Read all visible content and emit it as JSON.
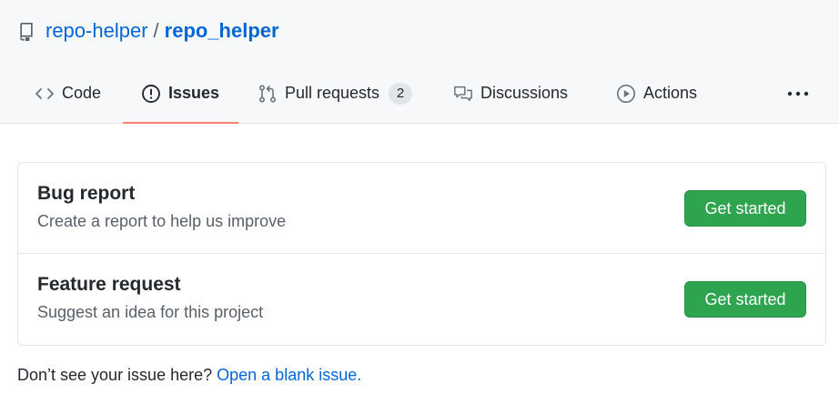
{
  "repo": {
    "owner": "repo-helper",
    "separator": "/",
    "name": "repo_helper"
  },
  "tabs": [
    {
      "label": "Code",
      "icon": "code-icon",
      "selected": false
    },
    {
      "label": "Issues",
      "icon": "issue-opened-icon",
      "selected": true
    },
    {
      "label": "Pull requests",
      "icon": "git-pull-request-icon",
      "counter": "2",
      "selected": false
    },
    {
      "label": "Discussions",
      "icon": "comment-discussion-icon",
      "selected": false
    },
    {
      "label": "Actions",
      "icon": "play-icon",
      "selected": false
    }
  ],
  "more_icon": "kebab-horizontal-icon",
  "templates": [
    {
      "title": "Bug report",
      "description": "Create a report to help us improve",
      "button": "Get started"
    },
    {
      "title": "Feature request",
      "description": "Suggest an idea for this project",
      "button": "Get started"
    }
  ],
  "footer": {
    "text": "Don’t see your issue here?",
    "link": "Open a blank issue."
  },
  "colors": {
    "link": "#0366d6",
    "primary_button": "#2ea44f",
    "selected_tab_underline": "#f9826c",
    "header_bg": "#f6f8fa"
  }
}
